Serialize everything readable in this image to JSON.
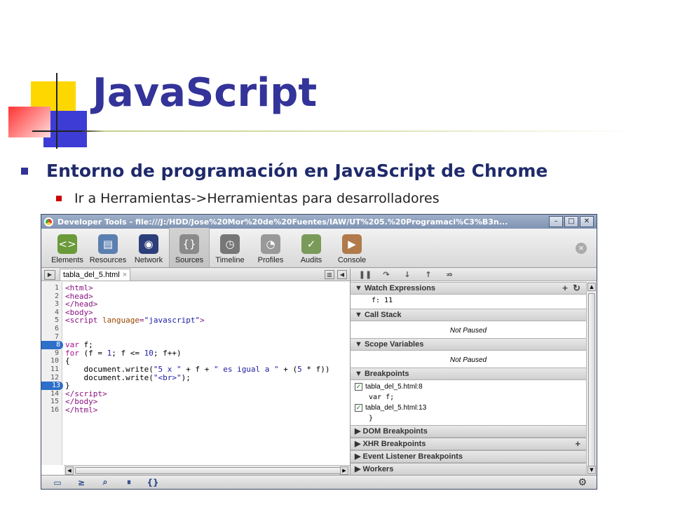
{
  "slide": {
    "title": "JavaScript",
    "bullet_main": "Entorno de programación en JavaScript de Chrome",
    "bullet_sub": "Ir a Herramientas->Herramientas para desarrolladores"
  },
  "window": {
    "title": "Developer Tools - file:///J:/HDD/Jose%20Mor%20de%20Fuentes/IAW/UT%205.%20Programaci%C3%B3n...",
    "controls": [
      "–",
      "□",
      "✕"
    ]
  },
  "toolbar": {
    "items": [
      {
        "label": "Elements",
        "icon": "elements-icon",
        "color": "#6a9a3a",
        "glyph": "<>"
      },
      {
        "label": "Resources",
        "icon": "resources-icon",
        "color": "#5a7fb0",
        "glyph": "▤"
      },
      {
        "label": "Network",
        "icon": "network-icon",
        "color": "#2c3f7a",
        "glyph": "◉"
      },
      {
        "label": "Sources",
        "icon": "sources-icon",
        "color": "#8a8a8a",
        "glyph": "{}"
      },
      {
        "label": "Timeline",
        "icon": "timeline-icon",
        "color": "#777777",
        "glyph": "◷"
      },
      {
        "label": "Profiles",
        "icon": "profiles-icon",
        "color": "#999999",
        "glyph": "◔"
      },
      {
        "label": "Audits",
        "icon": "audits-icon",
        "color": "#7a9a5a",
        "glyph": "✓"
      },
      {
        "label": "Console",
        "icon": "console-icon",
        "color": "#b07a4a",
        "glyph": "▶"
      }
    ],
    "active": "Sources"
  },
  "editor": {
    "tab": "tabla_del_5.html",
    "line_numbers": [
      "1",
      "2",
      "3",
      "4",
      "5",
      "6",
      "7",
      "8",
      "9",
      "10",
      "11",
      "12",
      "13",
      "14",
      "15",
      "16"
    ],
    "breakpoint_lines": [
      "8",
      "13"
    ]
  },
  "debugger": {
    "watch_title": "Watch Expressions",
    "watch_expr": "f: 11",
    "call_stack_title": "Call Stack",
    "call_stack_status": "Not Paused",
    "scope_title": "Scope Variables",
    "scope_status": "Not Paused",
    "breakpoints_title": "Breakpoints",
    "breakpoints": [
      {
        "label": "tabla_del_5.html:8",
        "code": "var f;"
      },
      {
        "label": "tabla_del_5.html:13",
        "code": "}"
      }
    ],
    "dom_bp_title": "DOM Breakpoints",
    "xhr_bp_title": "XHR Breakpoints",
    "event_bp_title": "Event Listener Breakpoints",
    "workers_title": "Workers"
  }
}
